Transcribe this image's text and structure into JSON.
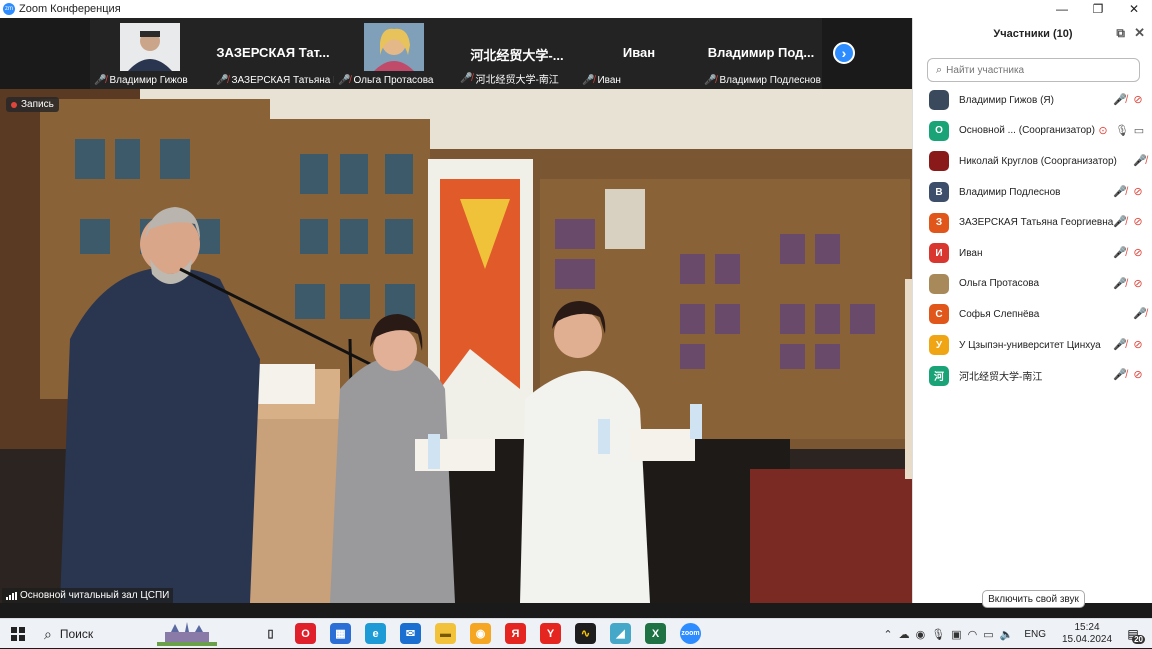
{
  "window": {
    "title": "Zoom Конференция",
    "logo": "zm"
  },
  "strip": {
    "tiles": [
      {
        "label": "Владимир Гижов",
        "big_name": "",
        "has_video": true
      },
      {
        "label": "ЗАЗЕРСКАЯ Татьяна Г...",
        "big_name": "ЗАЗЕРСКАЯ  Тат...",
        "has_video": false
      },
      {
        "label": "Ольга Протасова",
        "big_name": "",
        "has_video": true
      },
      {
        "label": "河北经贸大学-南江",
        "big_name": "河北经贸大学-...",
        "has_video": false
      },
      {
        "label": "Иван",
        "big_name": "Иван",
        "has_video": false
      },
      {
        "label": "Владимир Подлеснов",
        "big_name": "Владимир  Под...",
        "has_video": false
      }
    ],
    "next_icon": "chevron-right-icon"
  },
  "main_video": {
    "recording_label": "Запись",
    "source_label": "Основной читальный зал ЦСПИ"
  },
  "panel": {
    "title": "Участники (10)",
    "search_placeholder": "Найти участника",
    "participants": [
      {
        "name": "Владимир Гижов (Я)",
        "avatar": "",
        "color": "#3a4a5c",
        "mic": "muted",
        "cam": "off"
      },
      {
        "name": "Основной ...  (Соорганизатор)",
        "avatar": "О",
        "color": "#1aa376",
        "mic": "on",
        "cam": "on"
      },
      {
        "name": "Николай Круглов (Соорганизатор)",
        "avatar": "",
        "color": "#8a1a1a",
        "mic": "muted",
        "cam": "none"
      },
      {
        "name": "Владимир Подлеснов",
        "avatar": "В",
        "color": "#3d4e6b",
        "mic": "muted",
        "cam": "off"
      },
      {
        "name": "ЗАЗЕРСКАЯ Татьяна Георгиевна",
        "avatar": "З",
        "color": "#e0561b",
        "mic": "muted",
        "cam": "off"
      },
      {
        "name": "Иван",
        "avatar": "И",
        "color": "#d8362e",
        "mic": "muted",
        "cam": "off"
      },
      {
        "name": "Ольга Протасова",
        "avatar": "",
        "color": "#a88a5a",
        "mic": "muted",
        "cam": "off"
      },
      {
        "name": "Софья Слепнёва",
        "avatar": "С",
        "color": "#e0561b",
        "mic": "muted",
        "cam": "none"
      },
      {
        "name": "У Цзыпэн-университет Цинхуа",
        "avatar": "У",
        "color": "#f0a514",
        "mic": "muted",
        "cam": "off"
      },
      {
        "name": "河北经贸大学-南江",
        "avatar": "河",
        "color": "#1aa376",
        "mic": "muted",
        "cam": "off"
      }
    ],
    "unmute_button": "Включить свой звук"
  },
  "taskbar": {
    "search_label": "Поиск",
    "lang": "ENG",
    "time": "15:24",
    "date": "15.04.2024",
    "notifications": "20",
    "apps": [
      {
        "name": "task-view",
        "glyph": "▯",
        "color": "#eef1f6",
        "fg": "#222"
      },
      {
        "name": "opera",
        "glyph": "O",
        "color": "#e0202a",
        "fg": "#fff"
      },
      {
        "name": "store",
        "glyph": "▦",
        "color": "#2b6fd6",
        "fg": "#fff"
      },
      {
        "name": "edge",
        "glyph": "e",
        "color": "#1d9bd6",
        "fg": "#fff"
      },
      {
        "name": "mail",
        "glyph": "✉",
        "color": "#1a6fd0",
        "fg": "#fff"
      },
      {
        "name": "explorer",
        "glyph": "▬",
        "color": "#f2c23a",
        "fg": "#7a5a00"
      },
      {
        "name": "chrome-like",
        "glyph": "◉",
        "color": "#f5a623",
        "fg": "#fff"
      },
      {
        "name": "yandex",
        "glyph": "Я",
        "color": "#e52620",
        "fg": "#fff"
      },
      {
        "name": "yandex-browser",
        "glyph": "Y",
        "color": "#e52620",
        "fg": "#fff"
      },
      {
        "name": "yandex-music",
        "glyph": "∿",
        "color": "#1e1e1e",
        "fg": "#ffcc00"
      },
      {
        "name": "notes",
        "glyph": "◢",
        "color": "#45a8c8",
        "fg": "#fff"
      },
      {
        "name": "excel",
        "glyph": "X",
        "color": "#1f7244",
        "fg": "#fff"
      },
      {
        "name": "zoom",
        "glyph": "zoom",
        "color": "#2d8cff",
        "fg": "#fff"
      }
    ]
  }
}
